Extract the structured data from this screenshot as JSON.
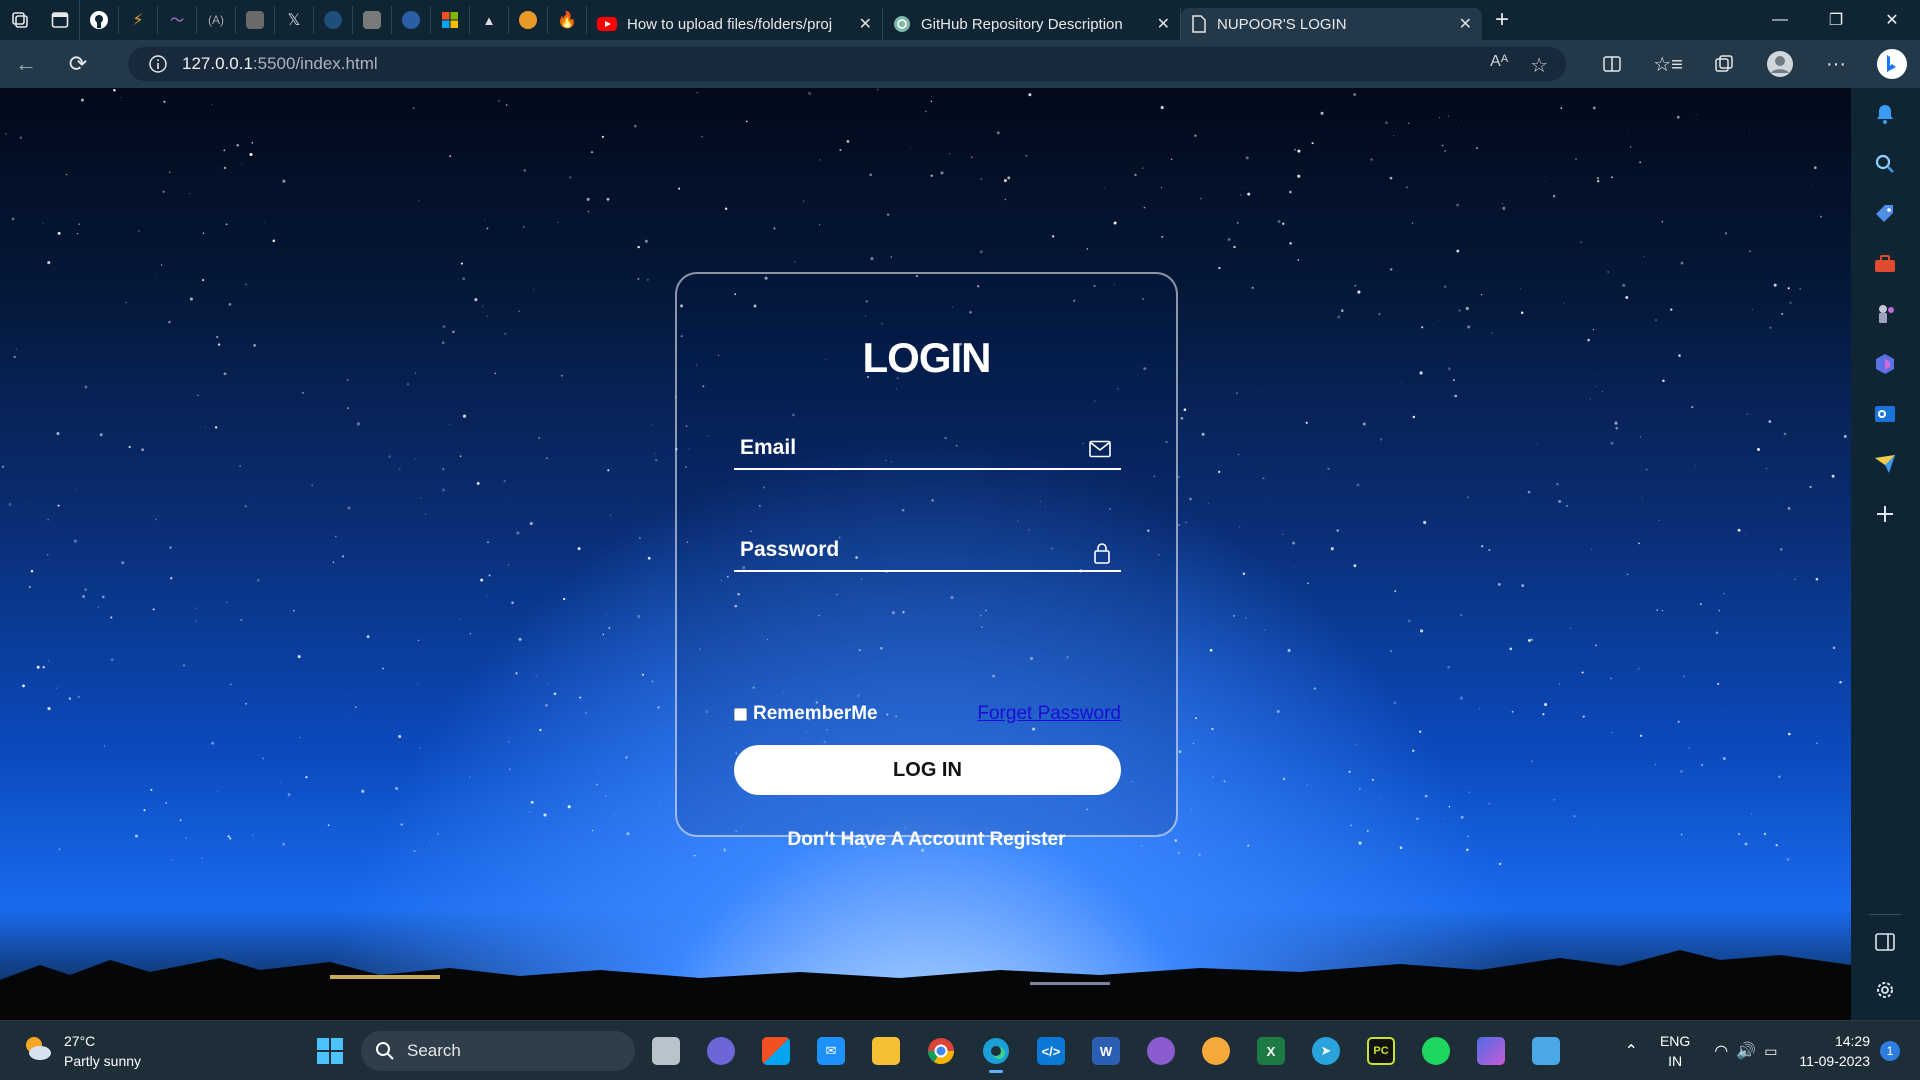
{
  "browser": {
    "pinned_tabs": [
      "workspaces-icon",
      "tab-actions-icon",
      "github-icon",
      "bolt-icon",
      "wave-icon",
      "ai-icon",
      "image-icon",
      "x-icon",
      "wordpress-icon",
      "image-icon",
      "cn-icon",
      "windows-store-icon",
      "triangle-icon",
      "bird-icon",
      "flame-icon"
    ],
    "tabs": [
      {
        "title": "How to upload files/folders/proj",
        "icon": "youtube-icon"
      },
      {
        "title": "GitHub Repository Description",
        "icon": "chatgpt-icon"
      },
      {
        "title": "NUPOOR'S LOGIN",
        "icon": "page-icon",
        "active": true
      }
    ],
    "new_tab": "+",
    "address": {
      "host": "127.0.0.1",
      "path": ":5500/index.html"
    }
  },
  "login": {
    "title": "LOGIN",
    "email_placeholder": "Email",
    "password_placeholder": "Password",
    "remember_label": "RememberMe",
    "forgot_label": "Forget Password",
    "button_label": "LOG IN",
    "register_prompt": "Don't Have A Account",
    "register_link": "Register"
  },
  "sidebar": {
    "items": [
      "bell-icon",
      "search-icon",
      "tag-icon",
      "toolbox-icon",
      "chess-icon",
      "copilot-icon",
      "outlook-icon",
      "send-icon",
      "plus-icon",
      "split-panel-icon",
      "settings-icon"
    ]
  },
  "taskbar": {
    "weather": {
      "temp": "27°C",
      "condition": "Partly sunny"
    },
    "search_label": "Search",
    "apps": [
      "task-view",
      "teams",
      "store",
      "mail",
      "explorer",
      "chrome",
      "edge",
      "vscode",
      "word",
      "github-desktop",
      "brave",
      "excel",
      "telegram",
      "pycharm",
      "spotify",
      "copilot",
      "notepad"
    ],
    "lang": {
      "line1": "ENG",
      "line2": "IN"
    },
    "time": "14:29",
    "date": "11-09-2023",
    "notification_count": "1"
  },
  "colors": {
    "accent": "#3a86ff",
    "tabbar": "#0f2534",
    "toolbar": "#23394a",
    "link": "#1a0dd6"
  }
}
